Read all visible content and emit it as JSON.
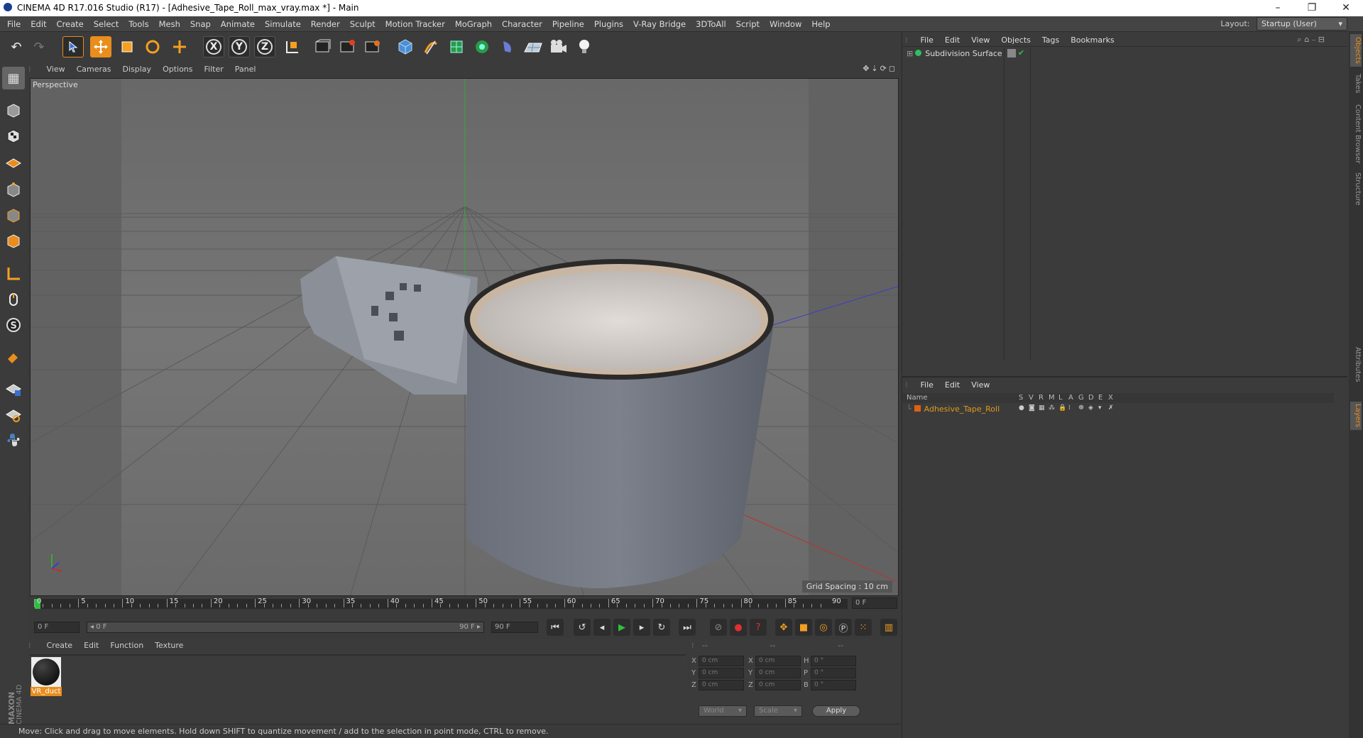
{
  "window": {
    "title": "CINEMA 4D R17.016 Studio (R17) - [Adhesive_Tape_Roll_max_vray.max *] - Main",
    "minimize_glyph": "–",
    "restore_glyph": "❐",
    "close_glyph": "✕"
  },
  "menubar": {
    "items": [
      "File",
      "Edit",
      "Create",
      "Select",
      "Tools",
      "Mesh",
      "Snap",
      "Animate",
      "Simulate",
      "Render",
      "Sculpt",
      "Motion Tracker",
      "MoGraph",
      "Character",
      "Pipeline",
      "Plugins",
      "V-Ray Bridge",
      "3DToAll",
      "Script",
      "Window",
      "Help"
    ],
    "layout_label": "Layout:",
    "layout_value": "Startup (User)"
  },
  "toolbar": {
    "axis_x": "X",
    "axis_y": "Y",
    "axis_z": "Z",
    "icons": [
      "undo-icon",
      "redo-icon",
      "select-pointer-icon",
      "move-icon",
      "scale-icon",
      "rotate-icon",
      "move-axis-icon",
      "axis-x-icon",
      "axis-y-icon",
      "axis-z-icon",
      "coord-system-icon",
      "render-view-icon",
      "render-picture-icon",
      "render-settings-icon",
      "cube-icon",
      "pen-icon",
      "subdivision-icon",
      "array-icon",
      "deformer-icon",
      "floor-icon",
      "camera-icon",
      "light-icon"
    ]
  },
  "viewport": {
    "menu": [
      "View",
      "Cameras",
      "Display",
      "Options",
      "Filter",
      "Panel"
    ],
    "name": "Perspective",
    "grid_spacing": "Grid Spacing : 10 cm"
  },
  "timeline": {
    "ticks": [
      "0",
      "5",
      "10",
      "15",
      "20",
      "25",
      "30",
      "35",
      "40",
      "45",
      "50",
      "55",
      "60",
      "65",
      "70",
      "75",
      "80",
      "85",
      "90"
    ],
    "current_frame": "0 F"
  },
  "transport": {
    "start_field": "0 F",
    "range_start": "◂ 0 F",
    "range_end": "90 F ▸",
    "end_field": "90 F"
  },
  "materials": {
    "menu": [
      "Create",
      "Edit",
      "Function",
      "Texture"
    ],
    "items": [
      {
        "name": "VR_duct"
      }
    ]
  },
  "coordinates": {
    "headers": [
      "--",
      "--",
      "--"
    ],
    "rows": [
      {
        "a": "X",
        "av": "0 cm",
        "b": "X",
        "bv": "0 cm",
        "c": "H",
        "cv": "0 °"
      },
      {
        "a": "Y",
        "av": "0 cm",
        "b": "Y",
        "bv": "0 cm",
        "c": "P",
        "cv": "0 °"
      },
      {
        "a": "Z",
        "av": "0 cm",
        "b": "Z",
        "bv": "0 cm",
        "c": "B",
        "cv": "0 °"
      }
    ],
    "mode1": "World",
    "mode2": "Scale",
    "apply": "Apply"
  },
  "status": {
    "text": "Move: Click and drag to move elements. Hold down SHIFT to quantize movement / add to the selection in point mode, CTRL to remove."
  },
  "objects_panel": {
    "menu": [
      "File",
      "Edit",
      "View",
      "Objects",
      "Tags",
      "Bookmarks"
    ],
    "items": [
      {
        "name": "Subdivision Surface"
      }
    ]
  },
  "layers_panel": {
    "menu": [
      "File",
      "Edit",
      "View"
    ],
    "columns": [
      "Name",
      "S",
      "V",
      "R",
      "M",
      "L",
      "A",
      "G",
      "D",
      "E",
      "X"
    ],
    "items": [
      {
        "name": "Adhesive_Tape_Roll",
        "color": "#e06010"
      }
    ]
  },
  "side_tabs": [
    "Objects",
    "Takes",
    "Content Browser",
    "Structure",
    "Attributes",
    "Layers"
  ],
  "brand": {
    "line1": "MAXON",
    "line2": "CINEMA 4D"
  },
  "colors": {
    "accent": "#e98d1d",
    "object_name": "#e09a1a",
    "x_axis": "#c03030",
    "y_axis": "#30b030",
    "z_axis": "#3040c0"
  }
}
